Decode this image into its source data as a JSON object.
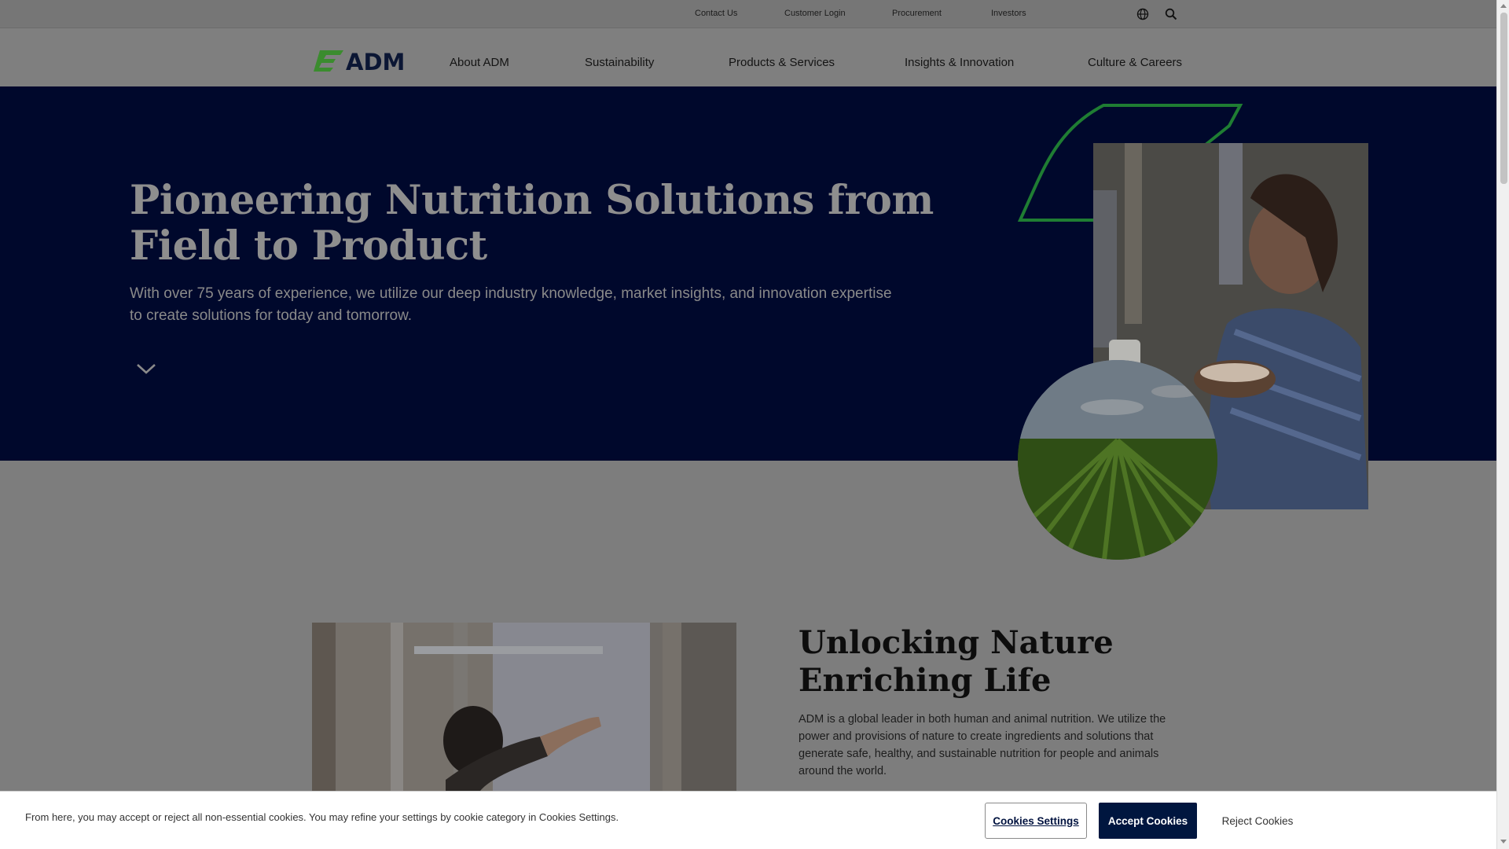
{
  "utility_nav": {
    "links": [
      "Contact Us",
      "Customer Login",
      "Procurement",
      "Investors"
    ],
    "icons": [
      "globe-icon",
      "search-icon"
    ]
  },
  "main_nav": {
    "logo_text": "ADM",
    "items": [
      "About ADM",
      "Sustainability",
      "Products & Services",
      "Insights & Innovation",
      "Culture & Careers"
    ]
  },
  "hero": {
    "title": "Pioneering Nutrition Solutions from Field to Product",
    "subtitle": "With over 75 years of experience, we utilize our deep industry knowledge, market insights, and innovation expertise to create solutions for today and tomorrow.",
    "scroll_icon": "chevron-down-icon"
  },
  "intro": {
    "title_line1": "Unlocking Nature",
    "title_line2": "Enriching Life",
    "body": "ADM is a global leader in both human and animal nutrition. We utilize the power and provisions of nature to create ingredients and solutions that generate safe, healthy, and sustainable nutrition for people and animals around the world."
  },
  "cookie_banner": {
    "text": "From here, you may accept or reject all non-essential cookies. You may refine your settings by cookie category in Cookies Settings.",
    "settings_label": "Cookies Settings",
    "accept_label": "Accept Cookies",
    "reject_label": "Reject Cookies"
  },
  "colors": {
    "brand_navy": "#00163f",
    "brand_green": "#2e8b3a",
    "hero_bg": "#00082c"
  }
}
